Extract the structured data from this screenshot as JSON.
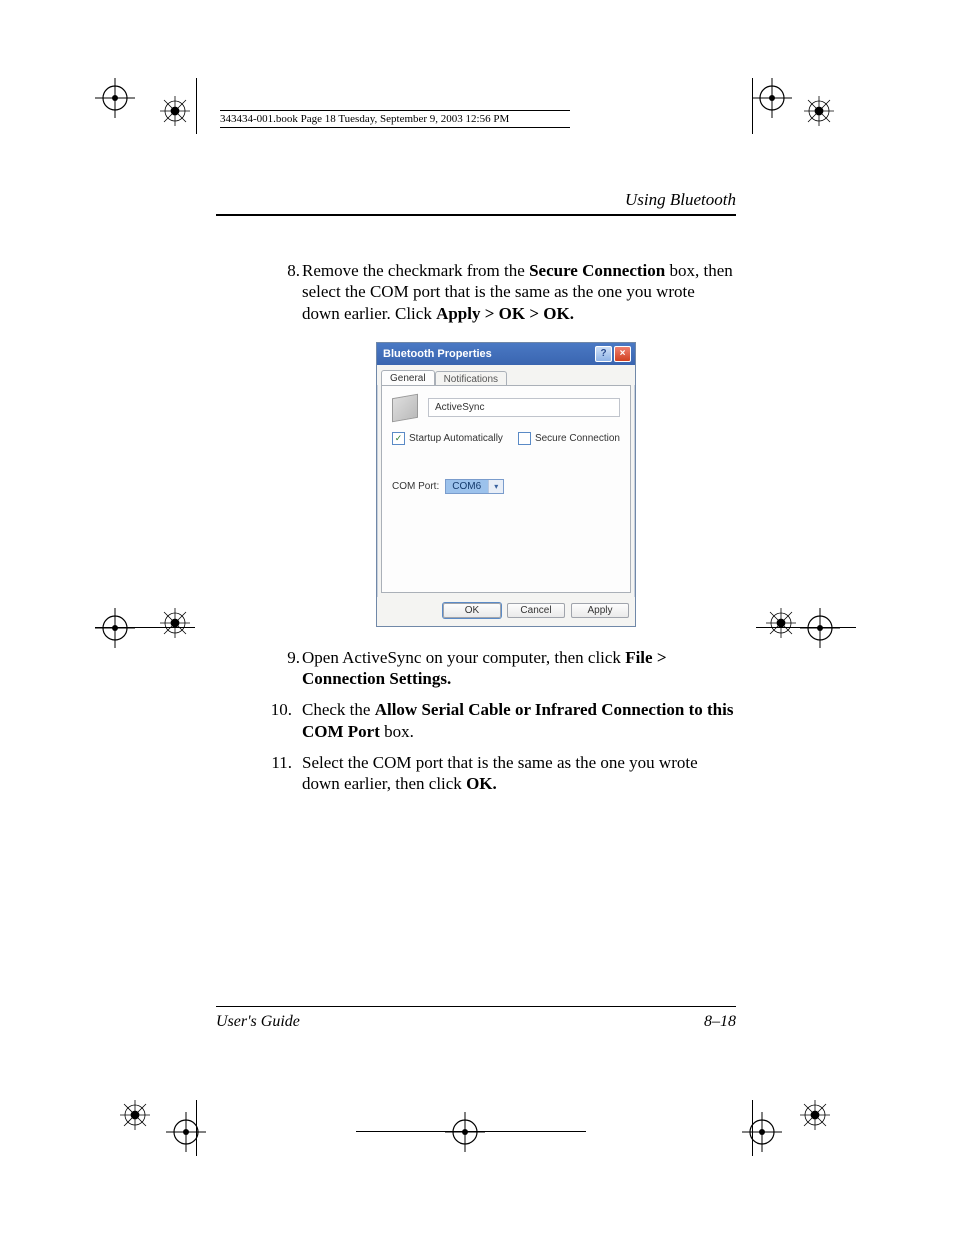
{
  "book_header": "343434-001.book  Page 18  Tuesday, September 9, 2003  12:56 PM",
  "section_header": "Using Bluetooth",
  "steps": {
    "s8": {
      "num": "8.",
      "t1": "Remove the checkmark from the ",
      "b1": "Secure Connection",
      "t2": " box, then select the COM port that is the same as the one you wrote down earlier. Click ",
      "b2": "Apply > OK > OK."
    },
    "s9": {
      "num": "9.",
      "t1": "Open ActiveSync on your computer, then click ",
      "b1": "File > Connection Settings."
    },
    "s10": {
      "num": "10.",
      "t1": "Check the ",
      "b1": "Allow Serial Cable or Infrared Connection to this COM Port",
      "t2": " box."
    },
    "s11": {
      "num": "11.",
      "t1": "Select the COM port that is the same as the one you wrote down earlier, then click ",
      "b1": "OK."
    }
  },
  "dialog": {
    "title": "Bluetooth Properties",
    "tabs": {
      "general": "General",
      "notifications": "Notifications"
    },
    "name_value": "ActiveSync",
    "startup_label": "Startup Automatically",
    "startup_checked": "✓",
    "secure_label": "Secure Connection",
    "comport_label": "COM Port:",
    "comport_value": "COM6",
    "buttons": {
      "ok": "OK",
      "cancel": "Cancel",
      "apply": "Apply"
    }
  },
  "footer": {
    "left": "User's Guide",
    "right": "8–18"
  }
}
